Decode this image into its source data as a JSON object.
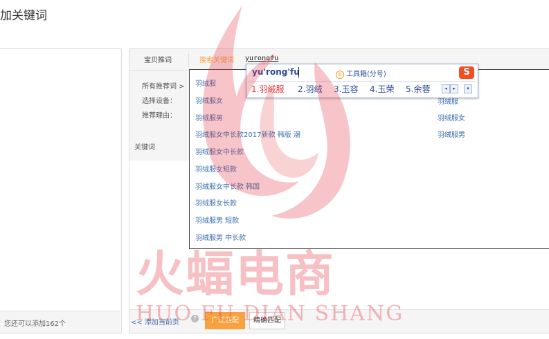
{
  "page": {
    "title": "加关键词"
  },
  "left_panel": {
    "footer_text": "您还可以添加162个"
  },
  "tabs": {
    "recommend": "宝贝推词",
    "search": "搜索关键词"
  },
  "search": {
    "value": "yurongfu"
  },
  "filters": {
    "all": "所有推荐词 >",
    "device": "选择设备：",
    "reason": "推荐理由："
  },
  "keywords_label": "关键词",
  "suggestions": [
    "羽绒服",
    "羽绒服女",
    "羽绒服男",
    "羽绒服女中长款2017新款 韩版 潮",
    "羽绒服女中长款",
    "羽绒服女短款",
    "羽绒服女中长款 韩国",
    "羽绒服女长款",
    "羽绒服男 短款",
    "羽绒服男 中长款"
  ],
  "side_list": {
    "header": "：",
    "items": [
      "羽绒服",
      "羽绒服女",
      "羽绒服男"
    ]
  },
  "ime": {
    "pinyin": "yu'rong'fu",
    "toolbox": "工具箱(分号)",
    "toolbox_badge": "①",
    "logo": "S",
    "candidates": [
      "1.羽绒服",
      "2.羽绒",
      "3.玉容",
      "4.玉荣",
      "5.余蓉"
    ],
    "prev": "◂",
    "next": "▸",
    "menu": "▾"
  },
  "bottom": {
    "add_link": "<< 添加当前页",
    "help": "?",
    "broad": "广泛匹配",
    "exact": "精确匹配"
  },
  "watermark": {
    "cn": "火蝠电商",
    "en": "HUO FU DIAN SHANG"
  },
  "colors": {
    "accent": "#f7a23e",
    "link": "#3e6fb0",
    "ime_text": "#2b4a9c",
    "ime_selected": "#e23a3a",
    "watermark": "#e4303c"
  }
}
